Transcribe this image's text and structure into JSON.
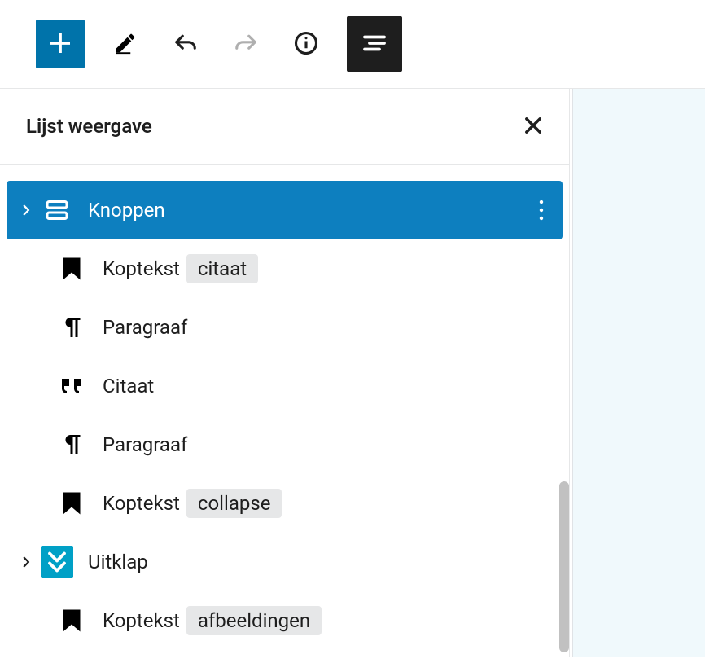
{
  "toolbar": {
    "add": "Add",
    "edit": "Edit",
    "undo": "Undo",
    "redo": "Redo",
    "info": "Info",
    "list_view": "List view"
  },
  "panel": {
    "title": "Lijst weergave",
    "close": "Close"
  },
  "blocks": [
    {
      "icon": "buttons",
      "label": "Knoppen",
      "selected": true,
      "toggle": true,
      "more": true
    },
    {
      "icon": "heading",
      "label": "Koptekst",
      "badge": "citaat",
      "indent": true
    },
    {
      "icon": "paragraph",
      "label": "Paragraaf",
      "indent": true
    },
    {
      "icon": "quote",
      "label": "Citaat",
      "indent": true
    },
    {
      "icon": "paragraph",
      "label": "Paragraaf",
      "indent": true
    },
    {
      "icon": "heading",
      "label": "Koptekst",
      "badge": "collapse",
      "indent": true
    },
    {
      "icon": "expand",
      "label": "Uitklap",
      "toggle": true,
      "filled": true
    },
    {
      "icon": "heading",
      "label": "Koptekst",
      "badge": "afbeeldingen",
      "indent": true
    }
  ],
  "colors": {
    "accent": "#0d7fbf",
    "teal": "#00a0c6"
  }
}
